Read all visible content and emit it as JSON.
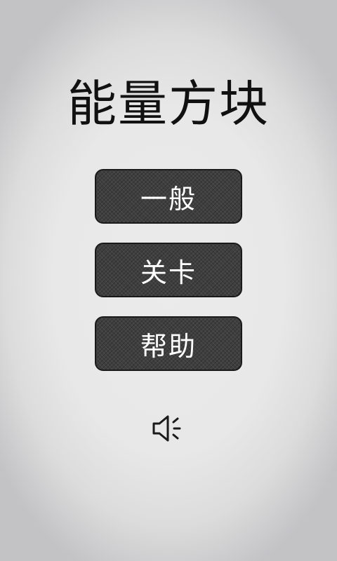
{
  "title": "能量方块",
  "menu": {
    "normal_label": "一般",
    "levels_label": "关卡",
    "help_label": "帮助"
  },
  "sound": {
    "icon": "speaker-icon"
  },
  "colors": {
    "button_fill": "#3f3f3f",
    "button_border": "#1a1a1a",
    "button_text": "#ffffff",
    "title_text": "#111111",
    "background": "#e8e8e8"
  }
}
